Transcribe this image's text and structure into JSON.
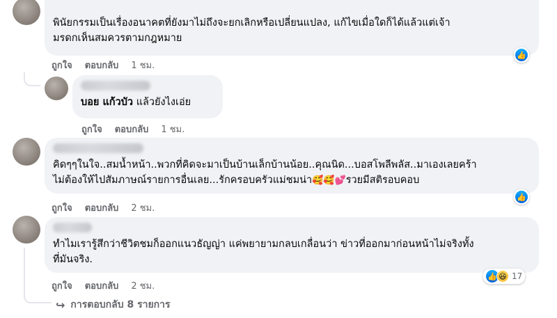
{
  "comments": [
    {
      "lines": [
        "พินัยกรรมเป็นเรื่องอนาคตที่ยังมาไม่ถึงจะยกเลิกหรือเปลี่ยนแปลง, แก้ไขเมื่อใดก็ได้แล้วแต่เจ้า",
        "มรดกเห็นสมควรตามกฎหมาย"
      ],
      "like_label": "ถูกใจ",
      "reply_label": "ตอบกลับ",
      "time": "1 ชม."
    },
    {
      "name": "บอย แก้วบัว",
      "text": "แล้วยังไงเอ่ย",
      "like_label": "ถูกใจ",
      "reply_label": "ตอบกลับ",
      "time": "1 ชม."
    },
    {
      "lines": [
        "คิดๆๆในใจ..สมน้ำหน้า..พวกที่คิดจะมาเป็นบ้านเล็กบ้านน้อย..คุณนิด...บอสโพลีพลัส..มาเองเลยคร้า",
        "ไม่ต้องให้ไปสัมภาษณ์รายการอื่นเลย...รักครอบครัวแม่ชมน่า",
        "รวยมีสติรอบคอบ"
      ],
      "emojis": [
        "🥰",
        "🥰",
        "💕"
      ],
      "like_label": "ถูกใจ",
      "reply_label": "ตอบกลับ",
      "time": "2 ชม."
    },
    {
      "lines": [
        "ทำไมเรารู้สึกว่าชีวิตชมก็ออกแนวธัญญ่า แค่พยายามกลบเกลื่อนว่า ข่าวที่ออกมาก่อนหน้าไม่จริงทั้ง",
        "ที่มันจริง."
      ],
      "like_label": "ถูกใจ",
      "reply_label": "ตอบกลับ",
      "time": "2 ชม.",
      "reaction_count": "17"
    }
  ],
  "more_replies": "การตอบกลับ 8 รายการ",
  "icons": {
    "like": "like-icon",
    "haha": "haha-icon",
    "reply_arrow": "reply-arrow-icon"
  },
  "colors": {
    "bubble": "#f0f2f5",
    "meta": "#65676b",
    "like_blue": "#1877f2"
  }
}
